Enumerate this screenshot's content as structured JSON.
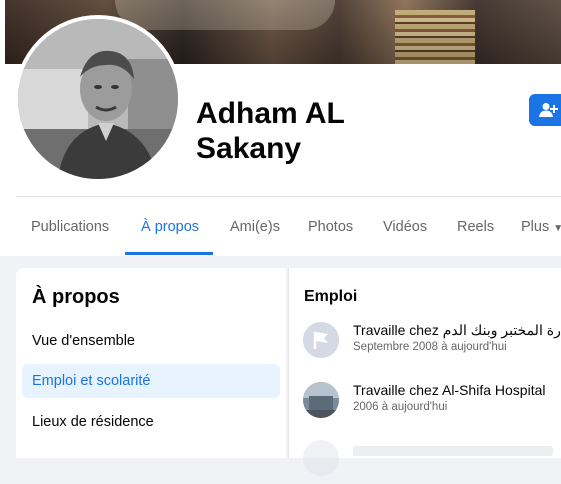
{
  "profile": {
    "name": "Adham AL Sakany"
  },
  "tabs": [
    {
      "label": "Publications"
    },
    {
      "label": "À propos"
    },
    {
      "label": "Ami(e)s"
    },
    {
      "label": "Photos"
    },
    {
      "label": "Vidéos"
    },
    {
      "label": "Reels"
    },
    {
      "label": "Plus"
    }
  ],
  "about": {
    "title": "À propos",
    "items": [
      {
        "label": "Vue d'ensemble"
      },
      {
        "label": "Emploi et scolarité"
      },
      {
        "label": "Lieux de résidence"
      }
    ]
  },
  "employment": {
    "title": "Emploi",
    "jobs": [
      {
        "prefix": "Travaille chez",
        "place": "ارة المختبر وبنك الدم",
        "dates": "Septembre 2008 à aujourd'hui"
      },
      {
        "prefix": "Travaille chez",
        "place": "Al-Shifa Hospital",
        "dates": "2006 à aujourd'hui"
      }
    ]
  },
  "colors": {
    "accent": "#1b74e4",
    "selected_bg": "#e7f3ff",
    "page_bg": "#f0f2f5"
  },
  "icons": {
    "add_friend": "add-friend-icon",
    "plus_dropdown": "chevron-down-icon",
    "work_1": "flag-icon",
    "work_2": "hospital-icon"
  }
}
